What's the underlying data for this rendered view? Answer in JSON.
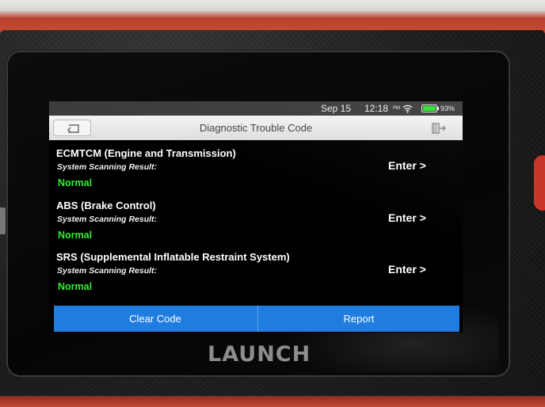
{
  "device": {
    "brand": "LAUNCH"
  },
  "status_bar": {
    "date": "Sep 15",
    "time": "12:18",
    "ampm": "PM",
    "battery": "93%",
    "icons": [
      "wifi-icon",
      "battery-icon"
    ]
  },
  "header": {
    "title": "Diagnostic Trouble Code",
    "back_icon": "back-arrow-icon",
    "exit_icon": "exit-icon"
  },
  "systems": [
    {
      "name": "ECMTCM (Engine and Transmission)",
      "scan_label": "System Scanning Result:",
      "status": "Normal",
      "enter_label": "Enter >"
    },
    {
      "name": "ABS (Brake Control)",
      "scan_label": "System Scanning Result:",
      "status": "Normal",
      "enter_label": "Enter >"
    },
    {
      "name": "SRS (Supplemental Inflatable Restraint System)",
      "scan_label": "System Scanning Result:",
      "status": "Normal",
      "enter_label": "Enter >"
    }
  ],
  "actions": {
    "clear_label": "Clear Code",
    "report_label": "Report"
  },
  "colors": {
    "status_normal": "#2ef02e",
    "action_bar": "#1f7de0",
    "title_bar": "#e8e8e8",
    "housing_red": "#c64a33"
  }
}
